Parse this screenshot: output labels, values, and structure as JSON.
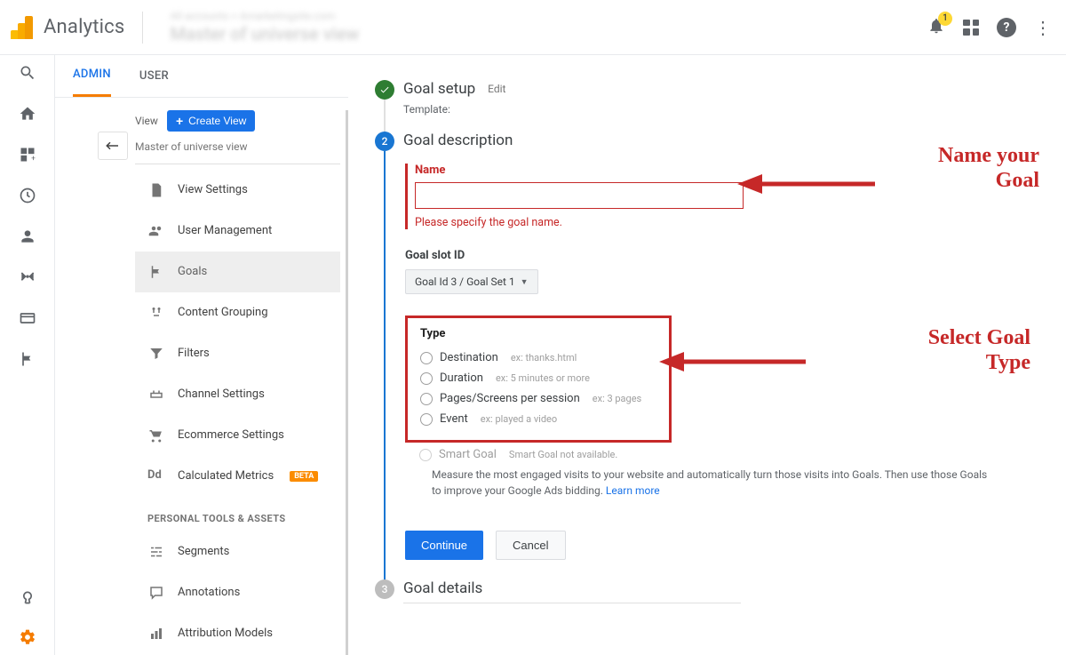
{
  "app": {
    "title": "Analytics"
  },
  "crumb": {
    "line1": "All accounts > Amarketingsite.com",
    "line2": "Master of universe view"
  },
  "notifications": {
    "count": "1"
  },
  "tabs": {
    "admin": "ADMIN",
    "user": "USER"
  },
  "view_panel": {
    "label": "View",
    "create_btn": "Create View",
    "subtitle": "Master of universe view",
    "items": [
      "View Settings",
      "User Management",
      "Goals",
      "Content Grouping",
      "Filters",
      "Channel Settings",
      "Ecommerce Settings",
      "Calculated Metrics"
    ],
    "beta": "BETA",
    "section": "PERSONAL TOOLS & ASSETS",
    "tools": [
      "Segments",
      "Annotations",
      "Attribution Models"
    ]
  },
  "step1": {
    "title": "Goal setup",
    "edit": "Edit",
    "sub": "Template:"
  },
  "step2": {
    "title": "Goal description",
    "number": "2",
    "name_label": "Name",
    "name_error": "Please specify the goal name.",
    "slot_label": "Goal slot ID",
    "slot_value": "Goal Id 3 / Goal Set 1",
    "type_label": "Type",
    "types": [
      {
        "label": "Destination",
        "ex": "ex: thanks.html"
      },
      {
        "label": "Duration",
        "ex": "ex: 5 minutes or more"
      },
      {
        "label": "Pages/Screens per session",
        "ex": "ex: 3 pages"
      },
      {
        "label": "Event",
        "ex": "ex: played a video"
      }
    ],
    "smart_label": "Smart Goal",
    "smart_note": "Smart Goal not available.",
    "smart_text": "Measure the most engaged visits to your website and automatically turn those visits into Goals. Then use those Goals to improve your Google Ads bidding. ",
    "learn_more": "Learn more",
    "continue": "Continue",
    "cancel": "Cancel"
  },
  "step3": {
    "title": "Goal details",
    "number": "3"
  },
  "annotations": {
    "name1": "Name your",
    "name2": "Goal",
    "type1": "Select Goal",
    "type2": "Type"
  }
}
